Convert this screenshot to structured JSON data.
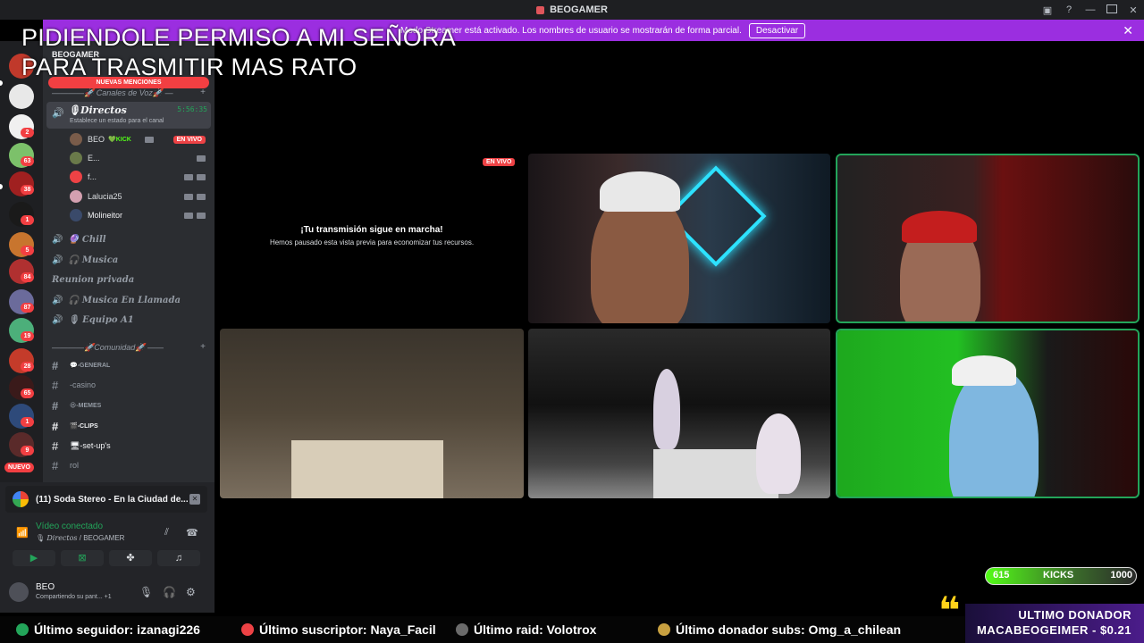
{
  "window": {
    "title": "BEOGAMER"
  },
  "banner": {
    "text": "Modo Streamer está activado. Los nombres de usuario se mostrarán de forma parcial.",
    "button": "Desactivar"
  },
  "overlay": {
    "headline": "PIDIENDOLE PERMISO A MI SEÑORA\nPARA TRASMITIR MAS RATO"
  },
  "rail": {
    "servers": [
      {
        "badge": ""
      },
      {
        "badge": ""
      },
      {
        "badge": "2"
      },
      {
        "badge": "63"
      },
      {
        "badge": "38"
      },
      {
        "badge": "1"
      },
      {
        "badge": "5"
      },
      {
        "badge": "84"
      },
      {
        "badge": "87"
      },
      {
        "badge": "19"
      },
      {
        "badge": "28"
      },
      {
        "badge": "65"
      },
      {
        "badge": "1"
      },
      {
        "badge": "9"
      }
    ],
    "new_label": "NUEVO"
  },
  "sidebar": {
    "server_name": "BEOGAMER",
    "mentions": "NUEVAS MENCIONES",
    "voice_category": "————🚀 Canales de Voz🚀 —",
    "active_channel": {
      "name": "🎙Directos",
      "status": "Establece un estado para el canal",
      "time": "5:56:35"
    },
    "members": [
      {
        "name": "BEO",
        "tag": "💚KICK",
        "live": "EN VIVO"
      },
      {
        "name": "E..."
      },
      {
        "name": "f..."
      },
      {
        "name": "Lalucia25"
      },
      {
        "name": "Molineitor"
      }
    ],
    "voice_channels": [
      "🔮 Chill",
      "🎧 Musica",
      "Reunion privada",
      "🎧 Musica En Llamada",
      "🎙 Equipo A1"
    ],
    "community_category": "————🚀Comunidad🚀 ——",
    "text_channels": [
      "💬-GENERAL",
      "-casino",
      "😆-MEMES",
      "🎬-CLIPS",
      "🖥-set-up's",
      "rol"
    ]
  },
  "panel": {
    "now_playing": "(11) Soda Stereo - En la Ciudad de...",
    "voice_connected": "Vídeo conectado",
    "voice_channel": "Directos",
    "voice_server": "BEOGAMER",
    "user_name": "BEO",
    "user_status": "Compartiendo su pant... +1"
  },
  "stage": {
    "paused_title": "¡Tu transmisión sigue en marcha!",
    "paused_subtitle": "Hemos pausado esta vista previa para economizar tus recursos.",
    "live_badge": "EN VIVO"
  },
  "kicks": {
    "current": "615",
    "label": "KICKS",
    "goal": "1000",
    "progress": 0.615
  },
  "ticker": {
    "follower": "Último seguidor: izanagi226",
    "subscriber": "Último suscriptor: Naya_Facil",
    "raid": "Último raid: Volotrox",
    "donor_subs": "Último donador subs: Omg_a_chilean"
  },
  "donor": {
    "title": "ULTIMO DONADOR",
    "name": "MACABEOGEIMER - $0.21"
  },
  "colors": {
    "accent": "#9b2ee0",
    "live": "#ed4245",
    "kick": "#53fc18",
    "online": "#23a55a"
  }
}
